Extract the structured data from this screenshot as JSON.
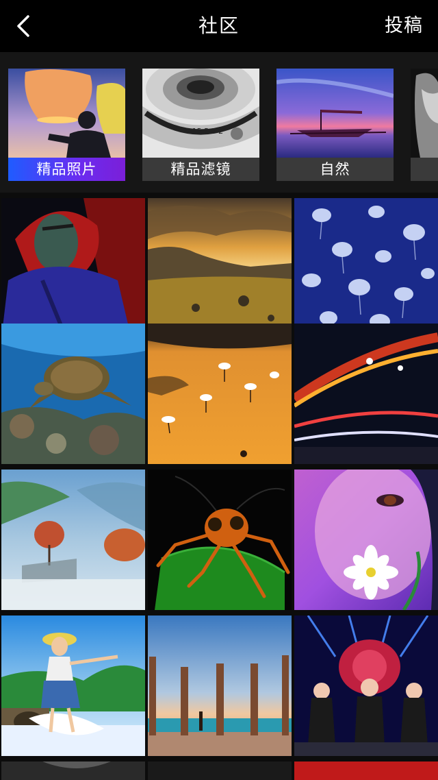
{
  "header": {
    "title": "社区",
    "post_label": "投稿"
  },
  "categories": [
    {
      "label": "精品照片",
      "active": true,
      "icon": "sky-lanterns-photo"
    },
    {
      "label": "精品滤镜",
      "active": false,
      "icon": "camera-lens-photo"
    },
    {
      "label": "自然",
      "active": false,
      "icon": "boat-sunset-photo"
    },
    {
      "label": "",
      "active": false,
      "icon": "portrait-bw-photo"
    }
  ],
  "grid": [
    {
      "icon": "portrait-man-hoodie-photo"
    },
    {
      "icon": "mountain-sunset-photo"
    },
    {
      "icon": "jellyfish-photo"
    },
    {
      "icon": "sea-turtle-photo"
    },
    {
      "icon": "egrets-sunset-photo"
    },
    {
      "icon": "city-light-trails-photo"
    },
    {
      "icon": "misty-village-photo"
    },
    {
      "icon": "ant-leaf-macro-photo"
    },
    {
      "icon": "woman-flower-portrait-photo"
    },
    {
      "icon": "child-splash-river-photo"
    },
    {
      "icon": "columns-beach-photo"
    },
    {
      "icon": "stage-performers-photo"
    }
  ]
}
